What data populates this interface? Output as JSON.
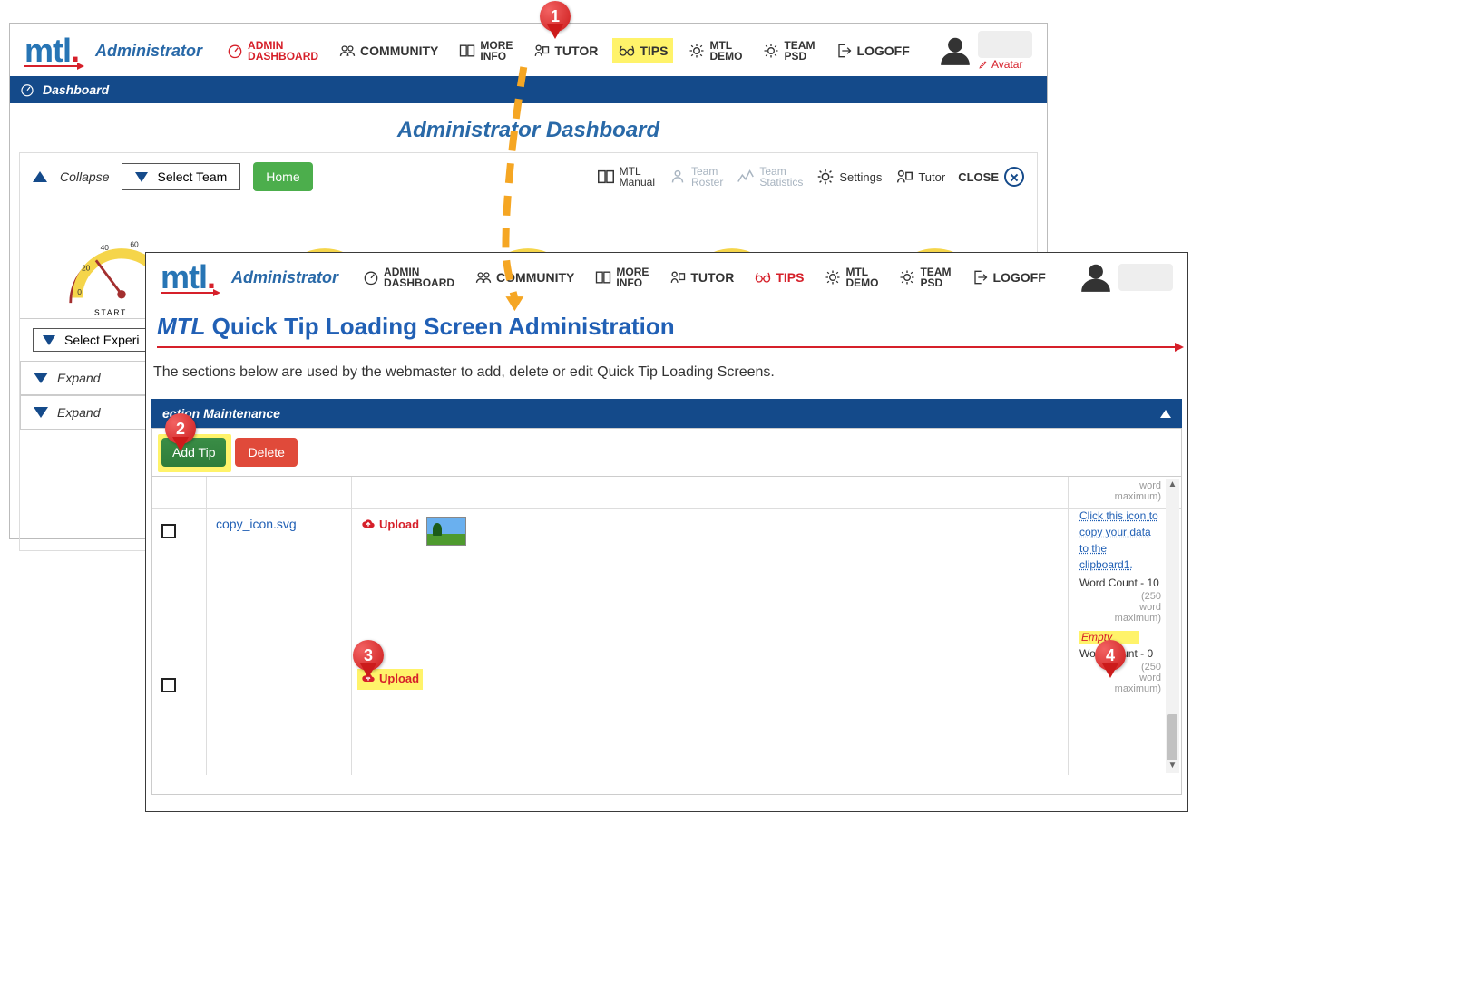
{
  "back": {
    "logo": "mtl",
    "role": "Administrator",
    "nav": {
      "admin_dashboard_l1": "ADMIN",
      "admin_dashboard_l2": "DASHBOARD",
      "community": "COMMUNITY",
      "more_info_l1": "MORE",
      "more_info_l2": "INFO",
      "tutor": "TUTOR",
      "tips": "TIPS",
      "mtl_demo_l1": "MTL",
      "mtl_demo_l2": "DEMO",
      "team_psd_l1": "TEAM",
      "team_psd_l2": "PSD",
      "logoff": "LOGOFF",
      "avatar": "Avatar"
    },
    "dashboard_title": "Dashboard",
    "admin_dashboard_heading": "Administrator Dashboard",
    "toolbar": {
      "collapse": "Collapse",
      "select_team": "Select Team",
      "home": "Home",
      "close": "CLOSE"
    },
    "right_tools": {
      "manual_l1": "MTL",
      "manual_l2": "Manual",
      "roster_l1": "Team",
      "roster_l2": "Roster",
      "stats_l1": "Team",
      "stats_l2": "Statistics",
      "settings": "Settings",
      "tutor": "Tutor"
    },
    "gauge_labels": {
      "t0": "0",
      "t20": "20",
      "t40": "40",
      "t60": "60",
      "start": "START"
    },
    "select_exp": "Select Experi",
    "expand": "Expand"
  },
  "front": {
    "logo": "mtl",
    "role": "Administrator",
    "nav": {
      "admin_dashboard_l1": "ADMIN",
      "admin_dashboard_l2": "DASHBOARD",
      "community": "COMMUNITY",
      "more_info_l1": "MORE",
      "more_info_l2": "INFO",
      "tutor": "TUTOR",
      "tips": "TIPS",
      "mtl_demo_l1": "MTL",
      "mtl_demo_l2": "DEMO",
      "team_psd_l1": "TEAM",
      "team_psd_l2": "PSD",
      "logoff": "LOGOFF"
    },
    "title_prefix": "MTL",
    "title_rest": " Quick Tip Loading Screen Administration",
    "description": "The sections below are used by the webmaster to add, delete or edit Quick Tip Loading Screens.",
    "section_heading": "ection Maintenance",
    "buttons": {
      "add_tip": "Add Tip",
      "delete": "Delete",
      "upload": "Upload"
    },
    "rows": [
      {
        "filename": "copy_icon.svg"
      },
      {
        "filename": ""
      }
    ],
    "data_pane": {
      "head_muted1": "word",
      "head_muted2": "maximum)",
      "link_text": "Click this icon to copy your data to the clipboard1.",
      "wc1_label": "Word Count - 10",
      "limit": "(250",
      "wm_word": "word",
      "wm_max": "maximum)",
      "empty": "Empty",
      "wc0_label": "Word Count - 0",
      "limit2": "(250",
      "wm2_word": "word",
      "wm2_max": "maximum)"
    }
  },
  "callouts": {
    "c1": "1",
    "c2": "2",
    "c3": "3",
    "c4": "4"
  }
}
